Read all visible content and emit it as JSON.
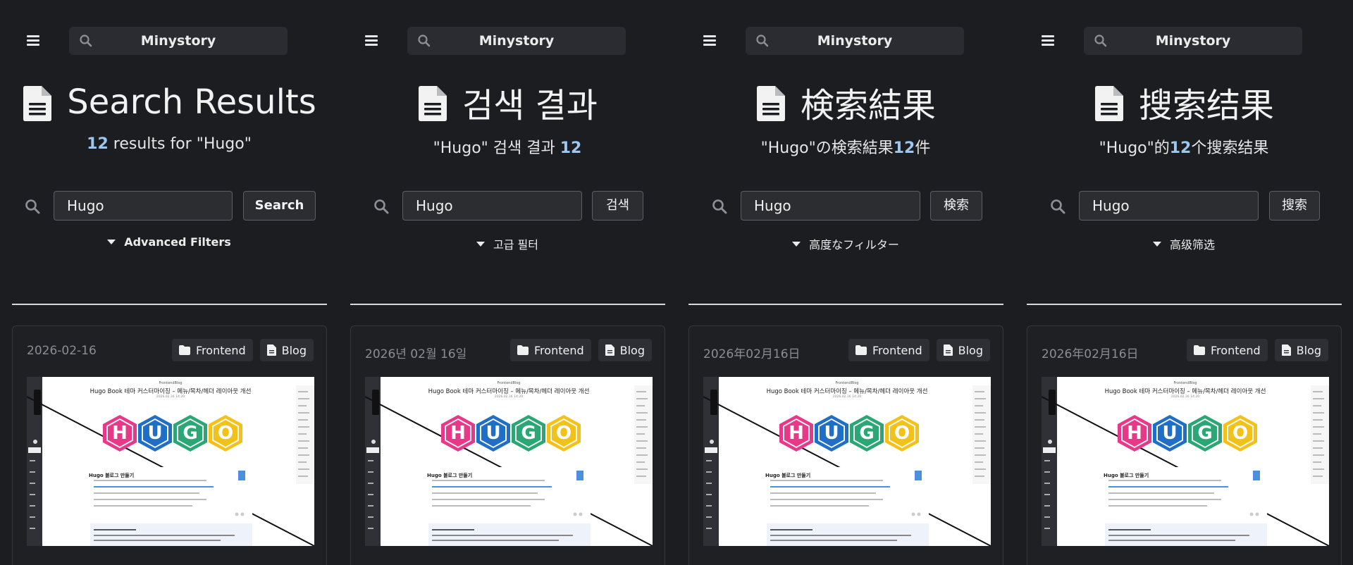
{
  "colors": {
    "background": "#1c1d21",
    "accent_number": "#9cc7ee",
    "hex_pink": "#e8388a",
    "hex_blue": "#1f6fc7",
    "hex_green": "#2aa775",
    "hex_yellow": "#f2c21b"
  },
  "icons": {
    "menu": "hamburger-icon",
    "search": "search-icon",
    "page": "document-icon",
    "folder": "folder-icon",
    "file": "file-icon",
    "caret": "caret-down-icon"
  },
  "panels": [
    {
      "brand": "Minystory",
      "title": "Search Results",
      "summary_before": "",
      "summary_count": "12",
      "summary_after": " results for \"Hugo\"",
      "query": "Hugo",
      "search_label": "Search",
      "filters_label": "Advanced Filters",
      "card": {
        "date": "2026-02-16",
        "tags": [
          "Frontend",
          "Blog"
        ],
        "thumb": {
          "blog": "FrontendBlog",
          "title": "Hugo Book 테마 커스터마이징 – 메뉴/목차/헤더 레이아웃 개선",
          "date": "2026.02.16 14:20",
          "letters": [
            "H",
            "U",
            "G",
            "O"
          ],
          "sub": "Hugo 블로그 만들기"
        }
      }
    },
    {
      "brand": "Minystory",
      "title": "검색 결과",
      "summary_before": "\"Hugo\" 검색 결과 ",
      "summary_count": "12",
      "summary_after": "",
      "query": "Hugo",
      "search_label": "검색",
      "filters_label": "고급 필터",
      "card": {
        "date": "2026년 02월 16일",
        "tags": [
          "Frontend",
          "Blog"
        ],
        "thumb": {
          "blog": "FrontendBlog",
          "title": "Hugo Book 테마 커스터마이징 – 메뉴/목차/헤더 레이아웃 개선",
          "date": "2026.02.16 14:20",
          "letters": [
            "H",
            "U",
            "G",
            "O"
          ],
          "sub": "Hugo 블로그 만들기"
        }
      }
    },
    {
      "brand": "Minystory",
      "title": "検索結果",
      "summary_before": "\"Hugo\"の検索結果",
      "summary_count": "12",
      "summary_after": "件",
      "query": "Hugo",
      "search_label": "検索",
      "filters_label": "高度なフィルター",
      "card": {
        "date": "2026年02月16日",
        "tags": [
          "Frontend",
          "Blog"
        ],
        "thumb": {
          "blog": "FrontendBlog",
          "title": "Hugo Book 테마 커스터마이징 – 메뉴/목차/헤더 레이아웃 개선",
          "date": "2026.02.16 14:20",
          "letters": [
            "H",
            "U",
            "G",
            "O"
          ],
          "sub": "Hugo 블로그 만들기"
        }
      }
    },
    {
      "brand": "Minystory",
      "title": "搜索结果",
      "summary_before": "\"Hugo\"的",
      "summary_count": "12",
      "summary_after": "个搜索结果",
      "query": "Hugo",
      "search_label": "搜索",
      "filters_label": "高级筛选",
      "card": {
        "date": "2026年02月16日",
        "tags": [
          "Frontend",
          "Blog"
        ],
        "thumb": {
          "blog": "FrontendBlog",
          "title": "Hugo Book 테마 커스터마이징 – 메뉴/목차/헤더 레이아웃 개선",
          "date": "2026.02.16 14:20",
          "letters": [
            "H",
            "U",
            "G",
            "O"
          ],
          "sub": "Hugo 블로그 만들기"
        }
      }
    }
  ]
}
